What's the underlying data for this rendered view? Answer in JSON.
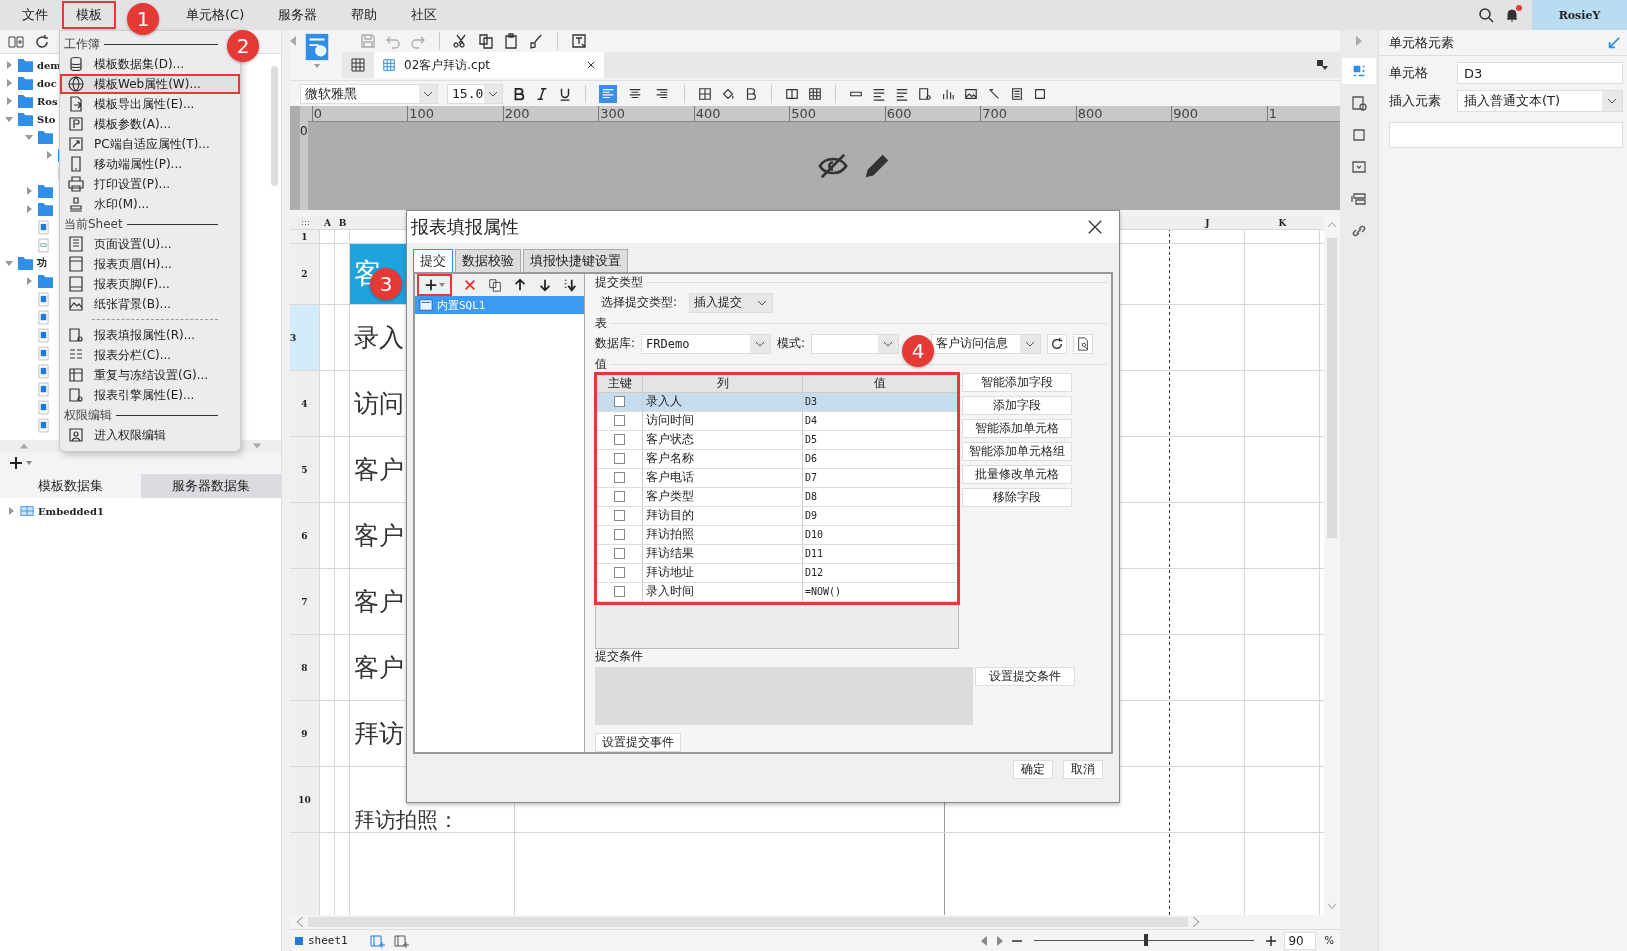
{
  "menubar": {
    "items": [
      {
        "label": "文件",
        "highlighted": false
      },
      {
        "label": "模板",
        "highlighted": true
      },
      {
        "label": "单元格(C)",
        "highlighted": false
      },
      {
        "label": "服务器",
        "highlighted": false
      },
      {
        "label": "帮助",
        "highlighted": false
      },
      {
        "label": "社区",
        "highlighted": false
      }
    ],
    "notification": true,
    "user": "RosieY"
  },
  "template_tree": [
    {
      "kind": "folder",
      "label": "dem",
      "expanded": false
    },
    {
      "kind": "folder",
      "label": "doc",
      "expanded": false
    },
    {
      "kind": "folder",
      "label": "Ros",
      "expanded": false
    },
    {
      "kind": "folder",
      "label": "Sto",
      "expanded": true,
      "children": [
        {
          "kind": "folder",
          "expanded": true,
          "children": [
            {
              "kind": "folder",
              "expanded": false
            },
            {
              "kind": "file"
            }
          ]
        },
        {
          "kind": "folder",
          "expanded": false
        },
        {
          "kind": "folder",
          "expanded": false
        },
        {
          "kind": "file"
        },
        {
          "kind": "form"
        }
      ]
    },
    {
      "kind": "folder",
      "label": "功",
      "expanded": true,
      "children": [
        {
          "kind": "folder",
          "expanded": false
        },
        {
          "kind": "file"
        },
        {
          "kind": "file"
        },
        {
          "kind": "file"
        },
        {
          "kind": "file"
        },
        {
          "kind": "file"
        },
        {
          "kind": "file"
        },
        {
          "kind": "file"
        },
        {
          "kind": "file"
        }
      ]
    }
  ],
  "dataset_tabs": [
    {
      "label": "模板数据集",
      "selected": true
    },
    {
      "label": "服务器数据集",
      "selected": false
    }
  ],
  "dataset_tree": [
    {
      "label": "Embedded1",
      "expanded": false
    }
  ],
  "template_menu": [
    {
      "title": "工作簿",
      "items": [
        {
          "kind": "item",
          "label": "模板数据集(D)...",
          "highlighted": false
        },
        {
          "kind": "item",
          "label": "模板Web属性(W)...",
          "highlighted": true
        },
        {
          "kind": "item",
          "label": "模板导出属性(E)...",
          "highlighted": false
        },
        {
          "kind": "item",
          "label": "模板参数(A)...",
          "highlighted": false
        },
        {
          "kind": "item",
          "label": "PC端自适应属性(T)...",
          "highlighted": false
        },
        {
          "kind": "item",
          "label": "移动端属性(P)...",
          "highlighted": false
        },
        {
          "kind": "item",
          "label": "打印设置(P)...",
          "highlighted": false
        },
        {
          "kind": "item",
          "label": "水印(M)...",
          "highlighted": false
        }
      ]
    },
    {
      "title": "当前Sheet",
      "items": [
        {
          "kind": "item",
          "label": "页面设置(U)...",
          "highlighted": false
        },
        {
          "kind": "item",
          "label": "报表页眉(H)...",
          "highlighted": false
        },
        {
          "kind": "item",
          "label": "报表页脚(F)...",
          "highlighted": false
        },
        {
          "kind": "item",
          "label": "纸张背景(B)...",
          "highlighted": false
        },
        {
          "kind": "separator"
        },
        {
          "kind": "item",
          "label": "报表填报属性(R)...",
          "highlighted": false
        },
        {
          "kind": "item",
          "label": "报表分栏(C)...",
          "highlighted": false
        },
        {
          "kind": "item",
          "label": "重复与冻结设置(G)...",
          "highlighted": false
        },
        {
          "kind": "item",
          "label": "报表引擎属性(E)...",
          "highlighted": false
        }
      ]
    },
    {
      "title": "权限编辑",
      "items": [
        {
          "kind": "item",
          "label": "进入权限编辑",
          "highlighted": false
        }
      ]
    }
  ],
  "file_tab": {
    "label": "02客户拜访.cpt"
  },
  "format_bar": {
    "font": "微软雅黑",
    "size": "15.0",
    "align_buttons": [
      {
        "selected": true
      },
      {
        "selected": false
      },
      {
        "selected": false
      }
    ]
  },
  "ruler": {
    "ticks": [
      "0",
      "100",
      "200",
      "300",
      "400",
      "500",
      "600",
      "700",
      "800",
      "900",
      "1"
    ],
    "vertical_tick": "0"
  },
  "sheet": {
    "column_headers": [
      "A",
      "B",
      "J",
      "K"
    ],
    "rows": [
      {
        "number": "1",
        "kind": "blank",
        "selected": false
      },
      {
        "number": "2",
        "kind": "title",
        "text": "客",
        "selected": false
      },
      {
        "number": "3",
        "kind": "field",
        "text": "录入",
        "selected": true
      },
      {
        "number": "4",
        "kind": "field",
        "text": "访问",
        "selected": false
      },
      {
        "number": "5",
        "kind": "field",
        "text": "客户",
        "selected": false
      },
      {
        "number": "6",
        "kind": "field",
        "text": "客户",
        "selected": false
      },
      {
        "number": "7",
        "kind": "field",
        "text": "客户",
        "selected": false
      },
      {
        "number": "8",
        "kind": "field",
        "text": "客户",
        "selected": false
      },
      {
        "number": "9",
        "kind": "field",
        "text": "拜访",
        "selected": false
      },
      {
        "number": "10",
        "kind": "field",
        "text": "拜访拍照：",
        "selected": false
      }
    ]
  },
  "status_bar": {
    "sheet": "sheet1",
    "zoom": "90",
    "zoom_unit": "%",
    "level": 0.5
  },
  "right_panel": {
    "side_tabs": [
      {
        "selected": true
      },
      {
        "selected": false
      },
      {
        "selected": false
      },
      {
        "selected": false
      },
      {
        "selected": false
      },
      {
        "selected": false
      }
    ],
    "title": "单元格元素",
    "cell_label": "单元格",
    "cell": "D3",
    "insert_label": "插入元素",
    "insert": "插入普通文本(T)"
  },
  "dialog": {
    "title": "报表填报属性",
    "tabs": [
      {
        "label": "提交",
        "selected": true
      },
      {
        "label": "数据校验",
        "selected": false
      },
      {
        "label": "填报快捷键设置",
        "selected": false
      }
    ],
    "add_highlighted": true,
    "submissions": [
      {
        "label": "内置SQL1",
        "selected": true
      }
    ],
    "submit_type_heading": "提交类型",
    "submit_type_label": "选择提交类型:",
    "submit_type": "插入提交",
    "table_heading": "表",
    "database_label": "数据库:",
    "database": "FRDemo",
    "schema_label": "模式:",
    "table_name": "客户访问信息",
    "values_heading": "值",
    "columns": [
      "主键",
      "列",
      "值"
    ],
    "table_highlighted": true,
    "fields": [
      {
        "column": "录入人",
        "value": "D3",
        "key": false,
        "selected": true
      },
      {
        "column": "访问时间",
        "value": "D4",
        "key": false,
        "selected": false
      },
      {
        "column": "客户状态",
        "value": "D5",
        "key": false,
        "selected": false
      },
      {
        "column": "客户名称",
        "value": "D6",
        "key": false,
        "selected": false
      },
      {
        "column": "客户电话",
        "value": "D7",
        "key": false,
        "selected": false
      },
      {
        "column": "客户类型",
        "value": "D8",
        "key": false,
        "selected": false
      },
      {
        "column": "拜访目的",
        "value": "D9",
        "key": false,
        "selected": false
      },
      {
        "column": "拜访拍照",
        "value": "D10",
        "key": false,
        "selected": false
      },
      {
        "column": "拜访结果",
        "value": "D11",
        "key": false,
        "selected": false
      },
      {
        "column": "拜访地址",
        "value": "D12",
        "key": false,
        "selected": false
      },
      {
        "column": "录入时间",
        "value": "=NOW()",
        "key": false,
        "selected": false
      }
    ],
    "field_buttons": [
      "智能添加字段",
      "添加字段",
      "智能添加单元格",
      "智能添加单元格组",
      "批量修改单元格",
      "移除字段"
    ],
    "condition_heading": "提交条件",
    "condition_button": "设置提交条件",
    "event_button": "设置提交事件",
    "ok": "确定",
    "cancel": "取消"
  },
  "callouts": [
    "1",
    "2",
    "3",
    "4"
  ]
}
